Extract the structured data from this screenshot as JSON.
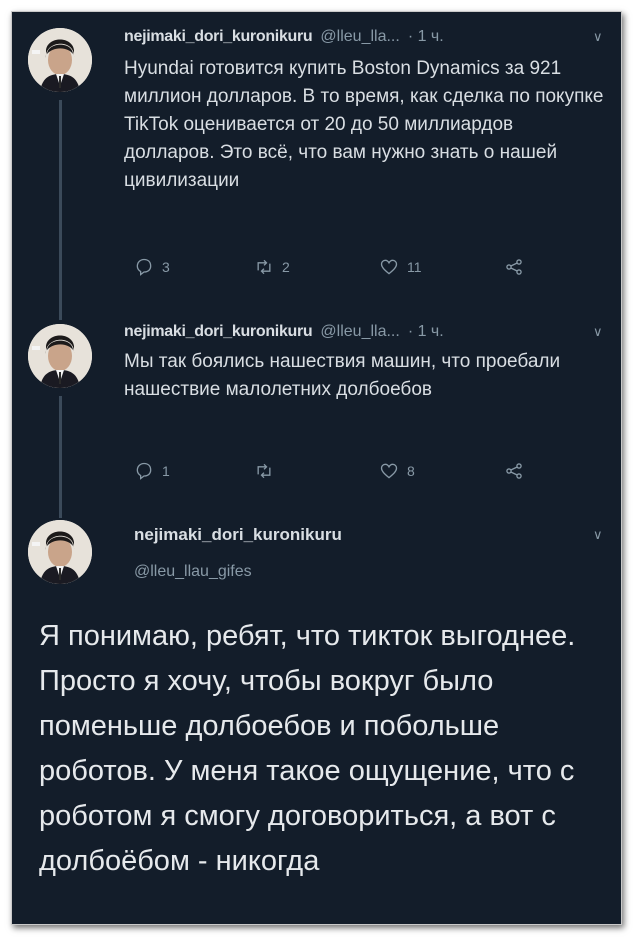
{
  "tweets": [
    {
      "name": "nejimaki_dori_kuronikuru",
      "handle": "@lleu_lla...",
      "time": "· 1 ч.",
      "text": "Hyundai готовится купить Boston Dynamics за 921 миллион долларов. В то время, как сделка по покупке TikTok оценивается от 20 до 50 миллиардов долларов. Это всё, что вам нужно знать о нашей цивилизации",
      "replies": "3",
      "retweets": "2",
      "likes": "11"
    },
    {
      "name": "nejimaki_dori_kuronikuru",
      "handle": "@lleu_lla...",
      "time": "· 1 ч.",
      "text": "Мы так боялись нашествия машин, что проебали нашествие малолетних долбоебов",
      "replies": "1",
      "retweets": "",
      "likes": "8"
    }
  ],
  "main": {
    "name": "nejimaki_dori_kuronikuru",
    "handle": "@lleu_llau_gifes",
    "text": "Я понимаю, ребят, что тикток выгоднее. Просто я хочу, чтобы вокруг было поменьше долбоебов и побольше роботов. У меня такое ощущение, что с роботом я смогу договориться, а вот с долбоёбом - никогда"
  },
  "icons": {
    "reply": "reply-icon",
    "retweet": "retweet-icon",
    "like": "heart-icon",
    "share": "share-icon",
    "caret": "chevron-down-icon"
  },
  "colors": {
    "background": "#131d2a",
    "text": "#d9dee3",
    "muted": "#8899a6",
    "thread_line": "#3b4a5a"
  }
}
